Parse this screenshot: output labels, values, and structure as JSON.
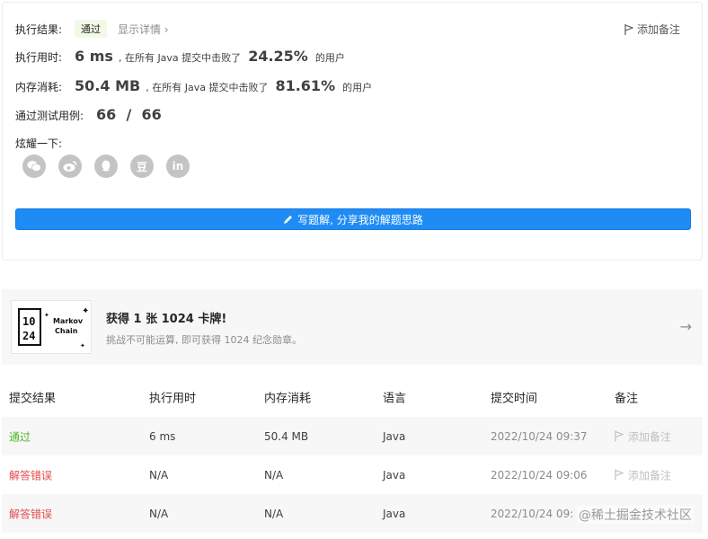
{
  "result": {
    "status_label": "执行结果:",
    "status_badge": "通过",
    "details_link": "显示详情 ›",
    "add_note": "添加备注",
    "time_label": "执行用时:",
    "time_value": "6 ms",
    "time_text": ", 在所有 Java 提交中击败了",
    "time_percent": "24.25%",
    "time_suffix": "的用户",
    "mem_label": "内存消耗:",
    "mem_value": "50.4 MB",
    "mem_text": ", 在所有 Java 提交中击败了",
    "mem_percent": "81.61%",
    "mem_suffix": "的用户",
    "cases_label": "通过测试用例:",
    "cases_value": "66  /  66",
    "share_label": "炫耀一下:",
    "share_icons": [
      "wechat-icon",
      "weibo-icon",
      "qq-icon",
      "douban-icon",
      "linkedin-icon"
    ],
    "share_douban": "豆",
    "share_linkedin": "in",
    "write_button": "写题解, 分享我的解题思路"
  },
  "achievement": {
    "card_text_1": "Markov",
    "card_text_2": "Chain",
    "card_numbers_top": "10",
    "card_numbers_bottom": "24",
    "title": "获得 1 张 1024 卡牌!",
    "subtitle": "挑战不可能运算, 即可获得 1024 纪念勋章。"
  },
  "table": {
    "headers": [
      "提交结果",
      "执行用时",
      "内存消耗",
      "语言",
      "提交时间",
      "备注"
    ],
    "rows": [
      {
        "result": "通过",
        "time": "6 ms",
        "memory": "50.4 MB",
        "lang": "Java",
        "submitted": "2022/10/24 09:37",
        "note": "添加备注"
      },
      {
        "result": "解答错误",
        "time": "N/A",
        "memory": "N/A",
        "lang": "Java",
        "submitted": "2022/10/24 09:06",
        "note": "添加备注"
      },
      {
        "result": "解答错误",
        "time": "N/A",
        "memory": "N/A",
        "lang": "Java",
        "submitted": "2022/10/24 09:",
        "note": ""
      }
    ]
  },
  "watermark": "@稀土掘金技术社区",
  "colors": {
    "accent": "#1f8cf5",
    "success": "#52b52a",
    "error": "#e34b4b"
  }
}
